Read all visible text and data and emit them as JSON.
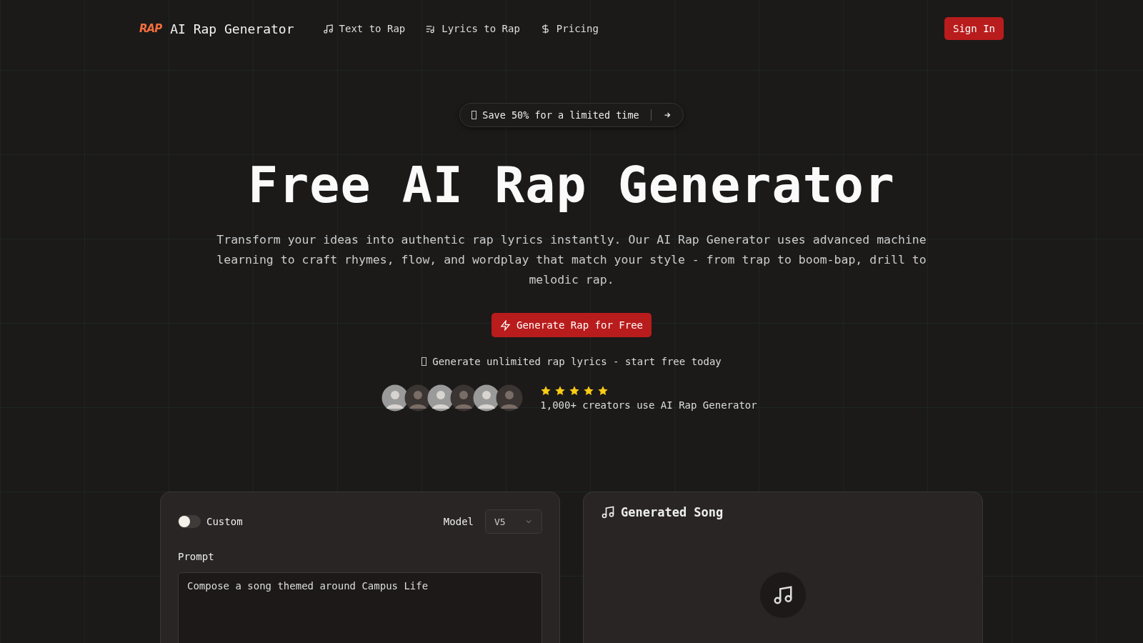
{
  "nav": {
    "logo_text": "RAP",
    "brand": "AI Rap Generator",
    "links": [
      {
        "label": "Text to Rap"
      },
      {
        "label": "Lyrics to Rap"
      },
      {
        "label": "Pricing"
      }
    ],
    "sign_in": "Sign In"
  },
  "promo": {
    "text": "Save 50% for a limited time"
  },
  "hero": {
    "title": "Free AI Rap Generator",
    "description": "Transform your ideas into authentic rap lyrics instantly. Our AI Rap Generator uses advanced machine learning to craft rhymes, flow, and wordplay that match your style - from trap to boom-bap, drill to melodic rap.",
    "cta": "Generate Rap for Free",
    "note": "Generate unlimited rap lyrics - start free today"
  },
  "social_proof": {
    "stars": 5,
    "text": "1,000+ creators use AI Rap Generator"
  },
  "form": {
    "custom": {
      "label": "Custom",
      "on": false
    },
    "model_label": "Model",
    "model_value": "V5",
    "prompt_label": "Prompt",
    "prompt_value": "Compose a song themed around Campus Life"
  },
  "output": {
    "title": "Generated Song"
  }
}
